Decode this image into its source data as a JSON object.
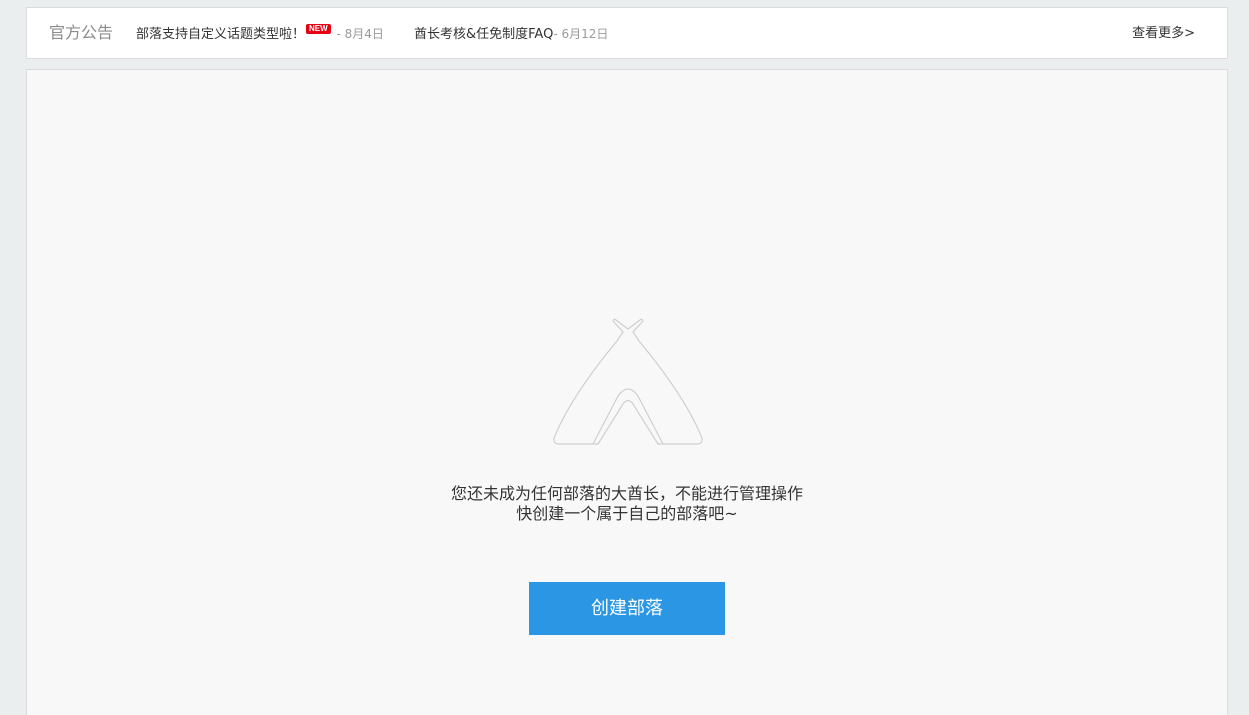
{
  "notice": {
    "title": "官方公告",
    "items": [
      {
        "text": "部落支持自定义话题类型啦！",
        "badge": "NEW",
        "date": " - 8月4日"
      },
      {
        "text": "酋长考核&任免制度FAQ",
        "date": "- 6月12日"
      }
    ],
    "more": "查看更多>"
  },
  "empty_state": {
    "icon": "tent-icon",
    "line1": "您还未成为任何部落的大酋长，不能进行管理操作",
    "line2": "快创建一个属于自己的部落吧~",
    "button": "创建部落"
  },
  "colors": {
    "accent": "#2b97e4",
    "badge": "#e60012",
    "background": "#ebeeee",
    "panel": "#f8f8f8"
  }
}
